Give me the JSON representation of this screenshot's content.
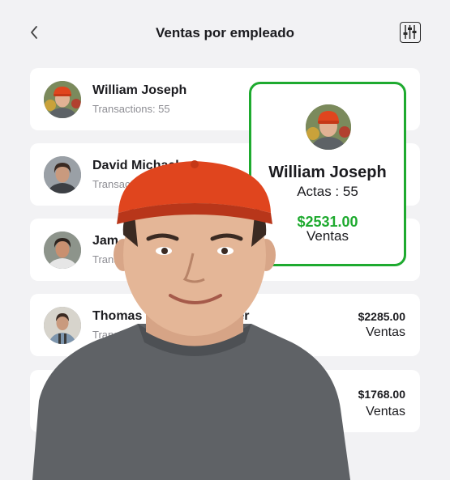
{
  "header": {
    "title": "Ventas por empleado",
    "back_icon": "chevron-left-icon",
    "filter_icon": "sliders-icon"
  },
  "employees": [
    {
      "name": "William Joseph",
      "subtitle": "Transactions: 55",
      "amount": "",
      "amount_label": ""
    },
    {
      "name": "David Michael",
      "subtitle": "Transactions",
      "amount": "",
      "amount_label": ""
    },
    {
      "name": "Jam",
      "subtitle": "Trans",
      "amount": "",
      "amount_label": ""
    },
    {
      "name": "Thomas",
      "subtitle": "Transacti",
      "name_tail": "er",
      "amount": "$2285.00",
      "amount_label": "Ventas"
    },
    {
      "name": "",
      "subtitle": "",
      "amount": "$1768.00",
      "amount_label": "Ventas"
    }
  ],
  "highlight": {
    "name": "William Joseph",
    "actas": "Actas : 55",
    "amount": "$2531.00",
    "amount_label": "Ventas",
    "accent": "#1eaa2f"
  },
  "colors": {
    "background": "#f2f2f4",
    "card": "#ffffff",
    "accent_green": "#1eaa2f",
    "cap_red": "#e0451e"
  }
}
